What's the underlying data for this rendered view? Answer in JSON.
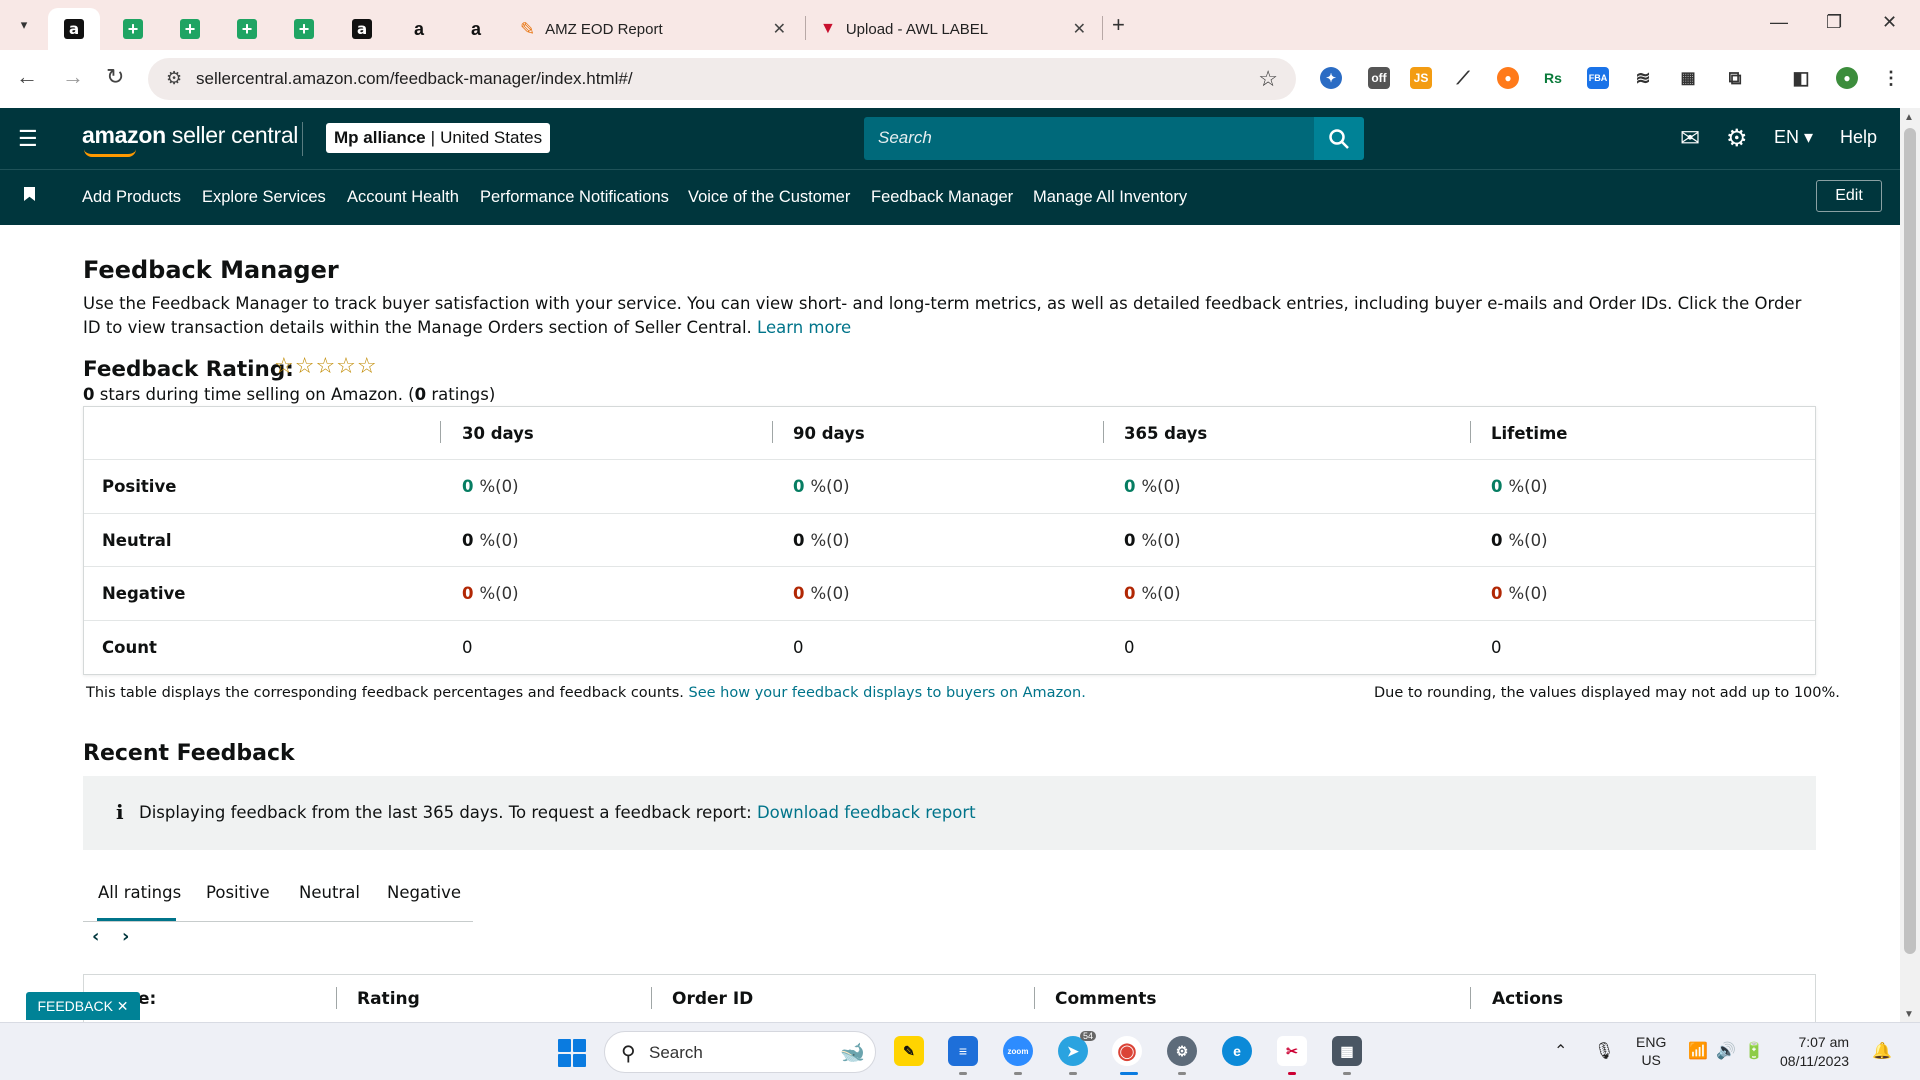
{
  "browser": {
    "tabs": [
      {
        "title": "AMZ EOD Report"
      },
      {
        "title": "Upload - AWL LABEL"
      }
    ],
    "url": "sellercentral.amazon.com/feedback-manager/index.html#/",
    "icons": {
      "back": "arrow-left-icon",
      "forward": "arrow-right-icon",
      "reload": "reload-icon",
      "bookmark": "star-icon"
    }
  },
  "header": {
    "logo_brand": "amazon",
    "logo_product": " seller central",
    "account_name": "Mp alliance",
    "account_separator": "|",
    "account_region": "United States",
    "search_placeholder": "Search",
    "language": "EN",
    "help": "Help"
  },
  "nav": {
    "items": [
      "Add Products",
      "Explore Services",
      "Account Health",
      "Performance Notifications",
      "Voice of the Customer",
      "Feedback Manager",
      "Manage All Inventory"
    ],
    "edit": "Edit"
  },
  "page": {
    "title": "Feedback Manager",
    "intro": "Use the Feedback Manager to track buyer satisfaction with your service. You can view short- and long-term metrics, as well as detailed feedback entries, including buyer e-mails and Order IDs. Click the Order ID to view transaction details within the Manage Orders section of Seller Central.",
    "learn_more": "Learn more",
    "rating_title": "Feedback Rating:",
    "stars": "☆☆☆☆☆",
    "summary_stars": "0",
    "summary_mid": " stars during time selling on Amazon. (",
    "summary_count": "0",
    "summary_end": " ratings)"
  },
  "feedback_table": {
    "columns": [
      "30 days",
      "90 days",
      "365 days",
      "Lifetime"
    ],
    "rows": {
      "positive": {
        "label": "Positive",
        "pct": "0",
        "rest": "%(0)"
      },
      "neutral": {
        "label": "Neutral",
        "pct": "0",
        "rest": "%(0)"
      },
      "negative": {
        "label": "Negative",
        "pct": "0",
        "rest": "%(0)"
      },
      "count": {
        "label": "Count",
        "value": "0"
      }
    },
    "note": "This table displays the corresponding feedback percentages and feedback counts.",
    "note_link": "See how your feedback displays to buyers on Amazon.",
    "rounding_note": "Due to rounding, the values displayed may not add up to 100%.",
    "status_colors": {
      "positive": "#067d62",
      "negative": "#b12704"
    }
  },
  "recent": {
    "title": "Recent Feedback",
    "info": "Displaying feedback from the last 365 days. To request a feedback report:",
    "info_link": "Download feedback report",
    "tabs": [
      "All ratings",
      "Positive",
      "Neutral",
      "Negative"
    ],
    "columns": [
      "Rating",
      "Order ID",
      "Comments",
      "Actions"
    ],
    "first_column_partial": "e:"
  },
  "feedback_badge": "FEEDBACK ✕",
  "taskbar": {
    "search": "Search",
    "lang_top": "ENG",
    "lang_bottom": "US",
    "time": "7:07 am",
    "date": "08/11/2023",
    "telegram_badge": "54"
  }
}
